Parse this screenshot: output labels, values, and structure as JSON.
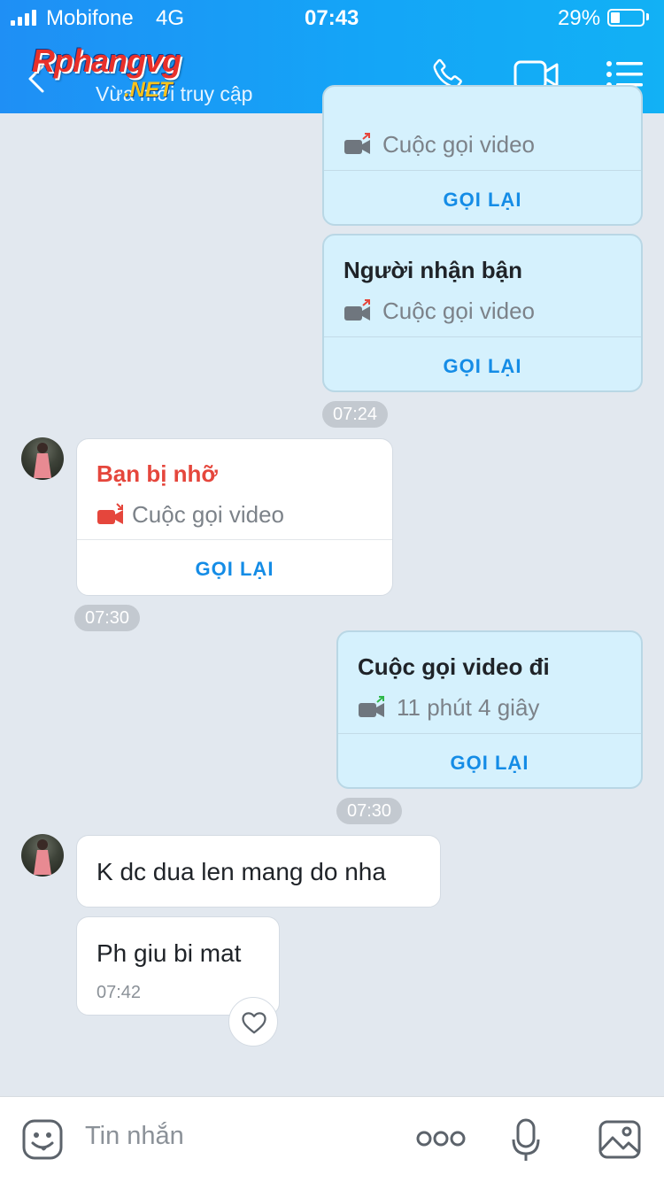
{
  "status_bar": {
    "carrier": "Mobifone",
    "network": "4G",
    "time": "07:43",
    "battery": "29%",
    "battery_level": 0.29
  },
  "header": {
    "logo_main": "Rphangvg",
    "logo_suffix": ".NET",
    "subtitle": "Vừa mới truy cập"
  },
  "messages": {
    "call1": {
      "subtitle": "Cuộc gọi video",
      "action": "GỌI LẠI"
    },
    "call2": {
      "title": "Người nhận bận",
      "subtitle": "Cuộc gọi video",
      "action": "GỌI LẠI"
    },
    "time1": "07:24",
    "call3": {
      "title": "Bạn bị nhỡ",
      "subtitle": "Cuộc gọi video",
      "action": "GỌI LẠI",
      "title_color": "#e5463c"
    },
    "time2": "07:30",
    "call4": {
      "title": "Cuộc gọi video đi",
      "subtitle": "11 phút 4 giây",
      "action": "GỌI LẠI"
    },
    "time3": "07:30",
    "text1": "K dc dua len mang do nha",
    "text2": {
      "body": "Ph giu bi mat",
      "time": "07:42"
    }
  },
  "input": {
    "placeholder": "Tin nhắn"
  },
  "colors": {
    "header_blue": "#1f8ff5",
    "accent": "#148ce6",
    "missed_red": "#e5463c",
    "outgoing_green": "#2fb84a",
    "arrow_red": "#e5463c"
  }
}
